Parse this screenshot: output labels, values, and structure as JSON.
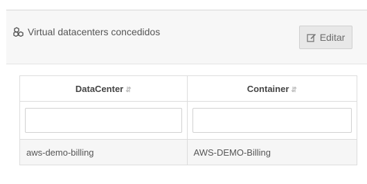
{
  "panel": {
    "title": "Virtual datacenters concedidos",
    "title_icon": "cubes-icon",
    "edit_button": {
      "label": "Editar",
      "icon": "edit-icon"
    }
  },
  "table": {
    "columns": [
      {
        "label": "DataCenter",
        "sortable": true
      },
      {
        "label": "Container",
        "sortable": true
      }
    ],
    "filters": [
      {
        "value": "",
        "placeholder": ""
      },
      {
        "value": "",
        "placeholder": ""
      }
    ],
    "rows": [
      {
        "datacenter": "aws-demo-billing",
        "container": "AWS-DEMO-Billing"
      }
    ]
  },
  "colors": {
    "header_bg": "#f7f7f7",
    "row_bg": "#f6f6f6",
    "button_bg": "#e8e8e8"
  }
}
